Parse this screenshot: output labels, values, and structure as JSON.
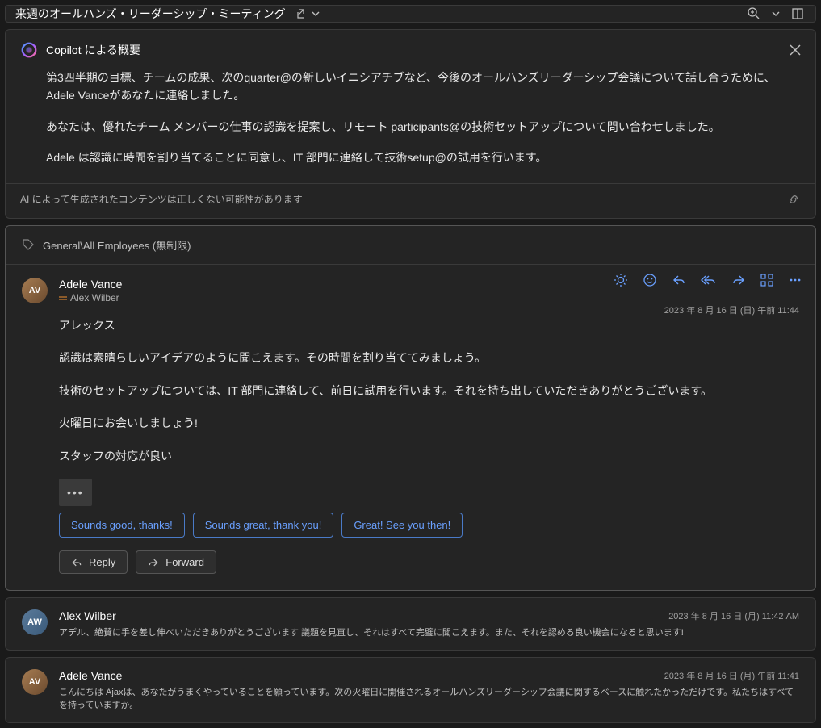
{
  "titlebar": {
    "subject": "来週のオールハンズ・リーダーシップ・ミーティング"
  },
  "copilot": {
    "title": "Copilot による概要",
    "p1": "第3四半期の目標、チームの成果、次のquarter@の新しいイニシアチブなど、今後のオールハンズリーダーシップ会議について話し合うために、Adele Vanceがあなたに連絡しました。",
    "p2": "あなたは、優れたチーム メンバーの仕事の認識を提案し、リモート participants@の技術セットアップについて問い合わせしました。",
    "p3": "Adele は認識に時間を割り当てることに同意し、IT 部門に連絡して技術setup@の試用を行います。",
    "disclaimer": "AI によって生成されたコンテンツは正しくない可能性があります"
  },
  "classification": "General\\All Employees (無制限)",
  "message1": {
    "sender": "Adele Vance",
    "to": "Alex Wilber",
    "date": "2023 年 8 月 16 日 (日) 午前 11:44",
    "b1": "アレックス",
    "b2": "認識は素晴らしいアイデアのように聞こえます。その時間を割り当ててみましょう。",
    "b3": "技術のセットアップについては、IT 部門に連絡して、前日に試用を行います。それを持ち出していただきありがとうございます。",
    "b4": "火曜日にお会いしましょう!",
    "b5": "スタッフの対応が良い",
    "avatar_initials": "AV"
  },
  "suggested": {
    "s1": "Sounds good, thanks!",
    "s2": "Sounds great, thank you!",
    "s3": "Great! See you then!"
  },
  "actions": {
    "reply": "Reply",
    "forward": "Forward"
  },
  "message2": {
    "sender": "Alex Wilber",
    "preview": "アデル、絶賛に手を差し伸べいただきありがとうございます 議題を見直し、それはすべて完璧に聞こえます。また、それを認める良い機会になると思います!",
    "date": "2023 年 8 月 16 日 (月)  11:42 AM",
    "avatar_initials": "AW"
  },
  "message3": {
    "sender": "Adele Vance",
    "preview": "こんにちは Ajaxは、あなたがうまくやっていることを願っています。次の火曜日に開催されるオールハンズリーダーシップ会議に関するベースに触れたかっただけです。私たちはすべてを持っていますか。",
    "date": "2023 年 8 月 16 日 (月) 午前 11:41",
    "avatar_initials": "AV"
  }
}
